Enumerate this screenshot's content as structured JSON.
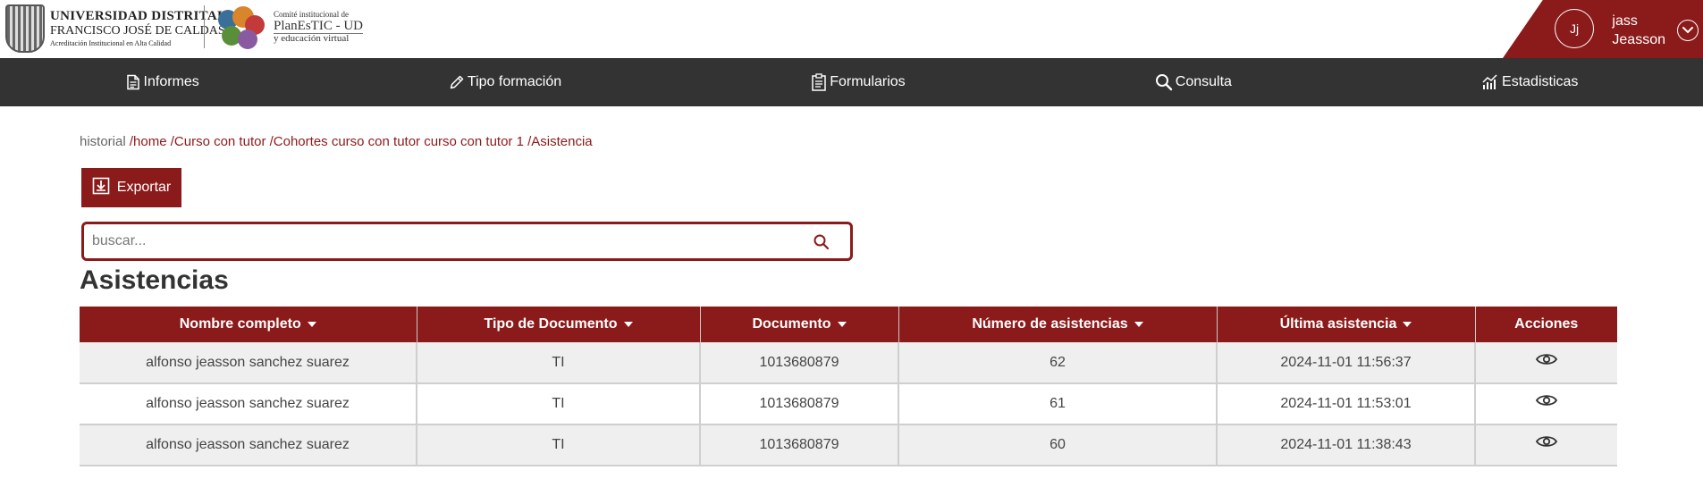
{
  "header": {
    "university": {
      "line1": "UNIVERSIDAD DISTRITAL",
      "line2": "FRANCISCO JOSÉ DE CALDAS",
      "line3": "Acreditación Institucional en Alta Calidad"
    },
    "plan": {
      "small": "Comité institucional de",
      "big": "PlanEsTIC - UD",
      "sub": "y educación virtual"
    },
    "user": {
      "initials": "Jj",
      "first": "jass",
      "last": "Jeasson"
    }
  },
  "nav": {
    "items": [
      {
        "label": "Informes",
        "icon": "document-icon"
      },
      {
        "label": "Tipo formación",
        "icon": "pencil-icon"
      },
      {
        "label": "Formularios",
        "icon": "clipboard-icon"
      },
      {
        "label": "Consulta",
        "icon": "search-icon"
      },
      {
        "label": "Estadisticas",
        "icon": "chart-icon"
      }
    ]
  },
  "breadcrumb": {
    "items": [
      "historial",
      "/home",
      "/Curso con tutor",
      "/Cohortes curso con tutor curso con tutor 1",
      "/Asistencia"
    ]
  },
  "toolbar": {
    "export_label": "Exportar"
  },
  "search": {
    "placeholder": "buscar...",
    "value": ""
  },
  "section_title": "Asistencias",
  "table": {
    "columns": [
      "Nombre completo",
      "Tipo de Documento",
      "Documento",
      "Número de asistencias",
      "Última asistencia",
      "Acciones"
    ],
    "rows": [
      [
        "alfonso jeasson sanchez suarez",
        "TI",
        "1013680879",
        "62",
        "2024-11-01 11:56:37"
      ],
      [
        "alfonso jeasson sanchez suarez",
        "TI",
        "1013680879",
        "61",
        "2024-11-01 11:53:01"
      ],
      [
        "alfonso jeasson sanchez suarez",
        "TI",
        "1013680879",
        "60",
        "2024-11-01 11:38:43"
      ]
    ]
  },
  "colors": {
    "brand": "#8b1a1a",
    "nav_bg": "#333333",
    "row_alt": "#efefef"
  }
}
